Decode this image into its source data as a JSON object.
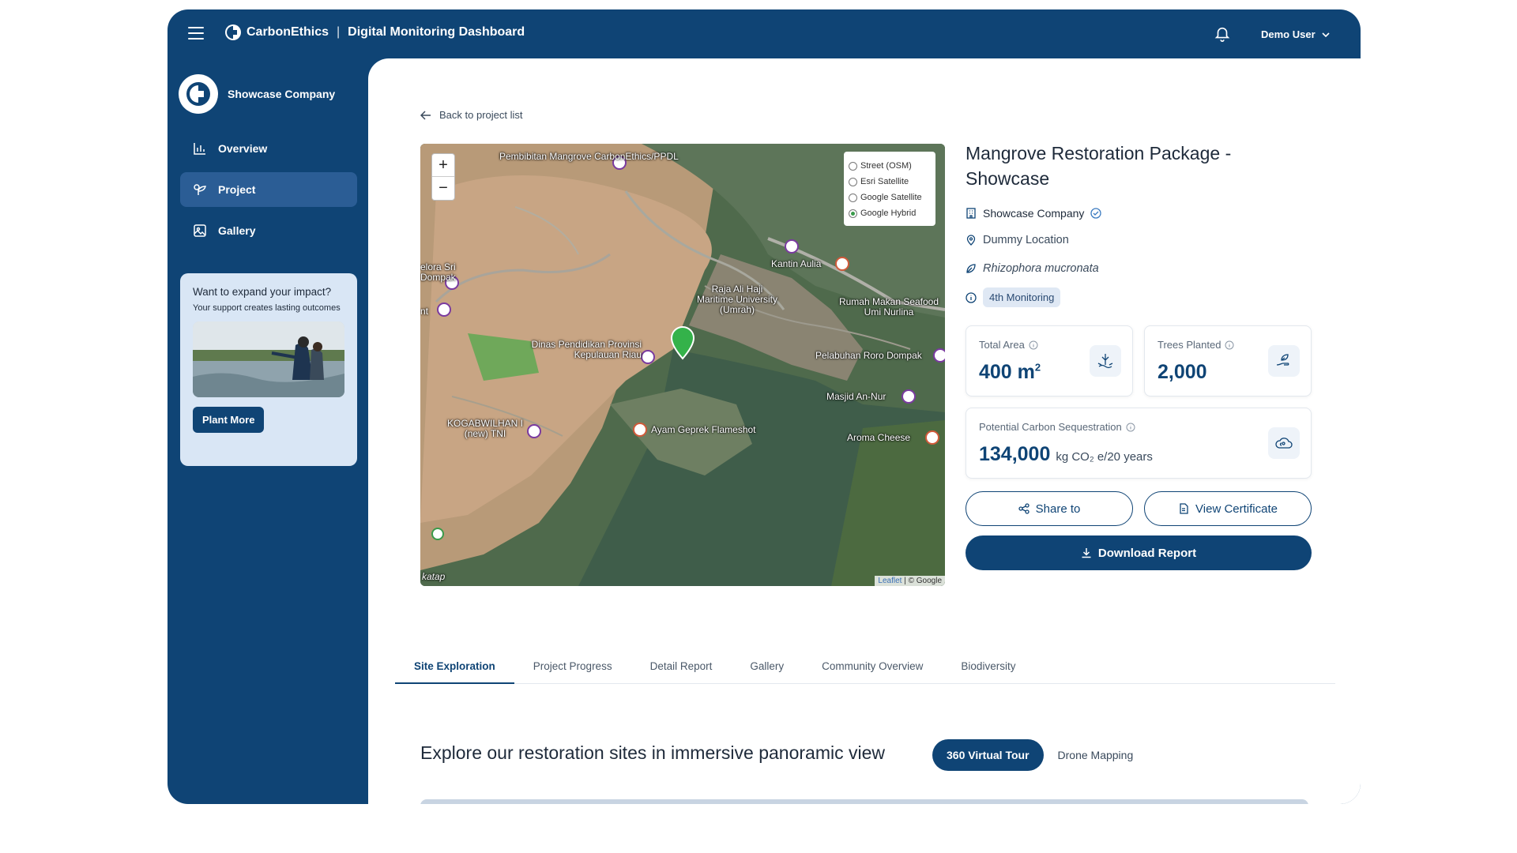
{
  "header": {
    "brand": "CarbonEthics",
    "separator": "|",
    "title": "Digital Monitoring Dashboard",
    "user": "Demo User"
  },
  "sidebar": {
    "company": "Showcase Company",
    "items": [
      {
        "label": "Overview",
        "icon": "bar-chart-icon"
      },
      {
        "label": "Project",
        "icon": "sprout-icon"
      },
      {
        "label": "Gallery",
        "icon": "image-icon"
      }
    ],
    "promo": {
      "title": "Want to expand your impact?",
      "subtitle": "Your support creates lasting outcomes",
      "button": "Plant More"
    }
  },
  "main": {
    "back_link": "Back to project list",
    "map": {
      "zoom_in": "+",
      "zoom_out": "−",
      "layers": [
        "Street (OSM)",
        "Esri Satellite",
        "Google Satellite",
        "Google Hybrid"
      ],
      "selected_layer": "Google Hybrid",
      "labels": [
        "Pembibitan Mangrove CarbonEthics/PPDL",
        "Kantin Aulia",
        "elora Sri Dompak",
        "Raja Ali Haji Maritime University (Umrah)",
        "Rumah Makan Seafood Umi Nurlina",
        "nt",
        "Dinas Pendidikan Provinsi Kepulauan Riau",
        "Pelabuhan Roro Dompak",
        "Masjid An-Nur",
        "KOGABWILHAN I (new) TNI",
        "Ayam Geprek Flameshot",
        "Aroma Cheese",
        "katap"
      ],
      "attribution_link": "Leaflet",
      "attribution_rest": " | © Google"
    },
    "project": {
      "title": "Mangrove Restoration Package - Showcase",
      "company": "Showcase Company",
      "location": "Dummy Location",
      "species": "Rhizophora mucronata",
      "monitoring": "4th Monitoring"
    },
    "stats": {
      "total_area_label": "Total Area",
      "total_area_value": "400 m",
      "total_area_sup": "2",
      "trees_label": "Trees Planted",
      "trees_value": "2,000",
      "carbon_label": "Potential Carbon Sequestration",
      "carbon_value": "134,000",
      "carbon_unit": "kg CO₂ e/20 years"
    },
    "actions": {
      "share": "Share to",
      "certificate": "View Certificate",
      "download": "Download Report"
    },
    "tabs": [
      "Site Exploration",
      "Project Progress",
      "Detail Report",
      "Gallery",
      "Community Overview",
      "Biodiversity"
    ],
    "active_tab": "Site Exploration",
    "explore_title": "Explore our restoration sites in immersive panoramic view",
    "view_toggle": [
      "360 Virtual Tour",
      "Drone Mapping"
    ],
    "active_view": "360 Virtual Tour"
  },
  "colors": {
    "primary": "#0f4475",
    "sidebar_active": "#2b5d95",
    "promo_bg": "#d9e6f5",
    "badge_bg": "#dfe8f4"
  }
}
